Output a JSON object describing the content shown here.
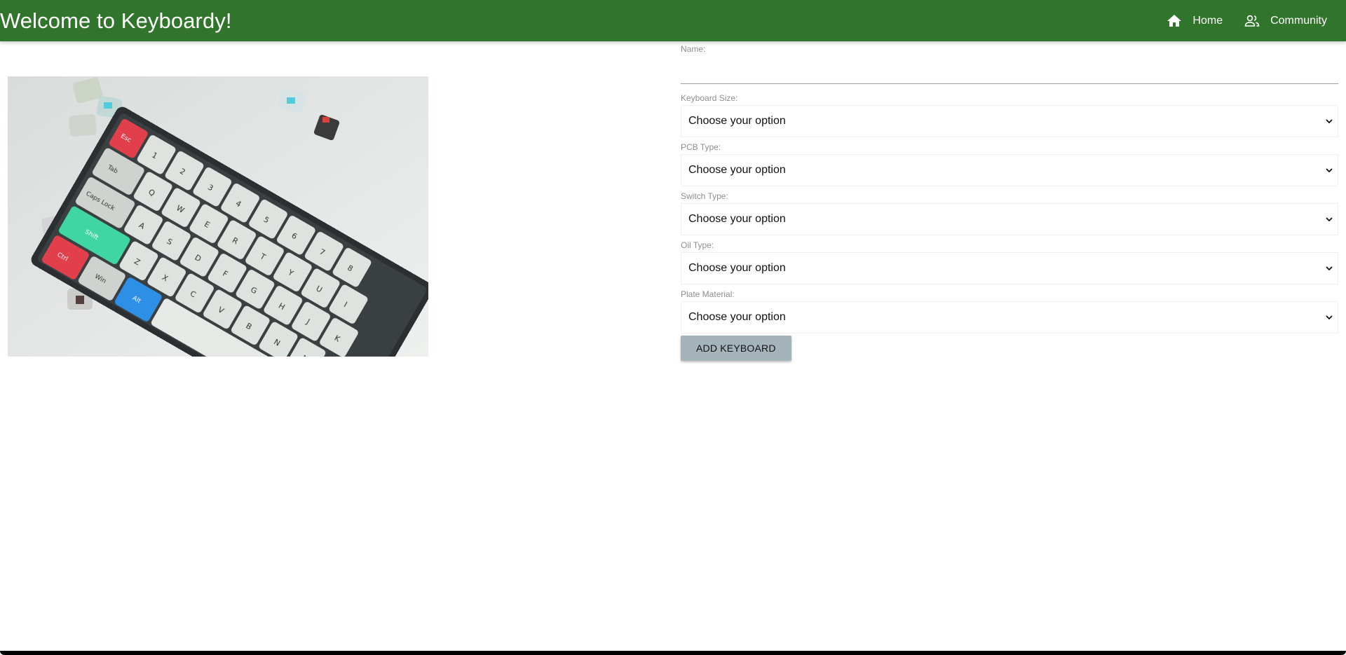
{
  "header": {
    "title": "Welcome to Keyboardy!",
    "nav": [
      {
        "label": "Home",
        "icon": "home-icon"
      },
      {
        "label": "Community",
        "icon": "people-icon"
      }
    ],
    "color": "#31752c"
  },
  "hero": {
    "image": "keyboard-photo"
  },
  "form": {
    "name_label": "Name:",
    "name_value": "",
    "fields": [
      {
        "label": "Keyboard Size:",
        "value": "Choose your option"
      },
      {
        "label": "PCB Type:",
        "value": "Choose your option"
      },
      {
        "label": "Switch Type:",
        "value": "Choose your option"
      },
      {
        "label": "Oil Type:",
        "value": "Choose your option"
      },
      {
        "label": "Plate Material:",
        "value": "Choose your option"
      }
    ],
    "submit_label": "ADD KEYBOARD",
    "submit_color": "#a5b3bb"
  }
}
